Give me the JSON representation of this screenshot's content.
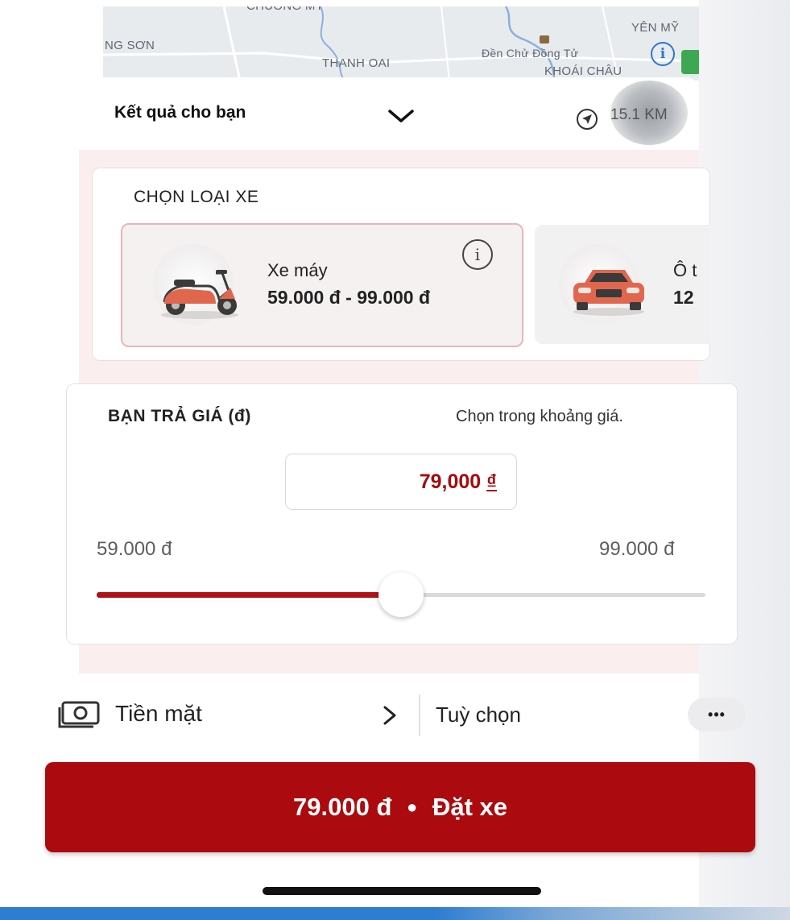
{
  "map": {
    "labels": {
      "chuong_my": "CHUONG MỸ",
      "yen_my": "YÊN MỸ",
      "ng_son": "NG SƠN",
      "thanh_oai": "THANH OAI",
      "den_chu_dong_tu": "Đền Chử Đồng Tử",
      "khoai_chau": "KHOÁI CHÂU"
    }
  },
  "header": {
    "title": "Kết quả cho bạn",
    "distance": "15.1 KM"
  },
  "vehicle_section": {
    "title": "CHỌN LOẠI XE",
    "options": [
      {
        "name": "Xe máy",
        "price": "59.000 đ - 99.000 đ",
        "icon": "scooter-icon",
        "selected": true
      },
      {
        "name": "Ô t",
        "price": "12",
        "icon": "car-icon",
        "selected": false
      }
    ]
  },
  "bid_section": {
    "title": "BẠN TRẢ GIÁ (đ)",
    "hint": "Chọn trong khoảng giá.",
    "price_value": "79,000",
    "currency": "₫",
    "min_label": "59.000 đ",
    "max_label": "99.000 đ",
    "slider_fraction": 0.5
  },
  "payment": {
    "method": "Tiền mặt",
    "options_label": "Tuỳ chọn",
    "more": "•••"
  },
  "cta": {
    "price": "79.000 đ",
    "separator": "●",
    "action": "Đặt xe"
  },
  "colors": {
    "accent": "#ab0b0f",
    "price_text": "#a50b0b",
    "vehicle_orange": "#e0674d"
  }
}
